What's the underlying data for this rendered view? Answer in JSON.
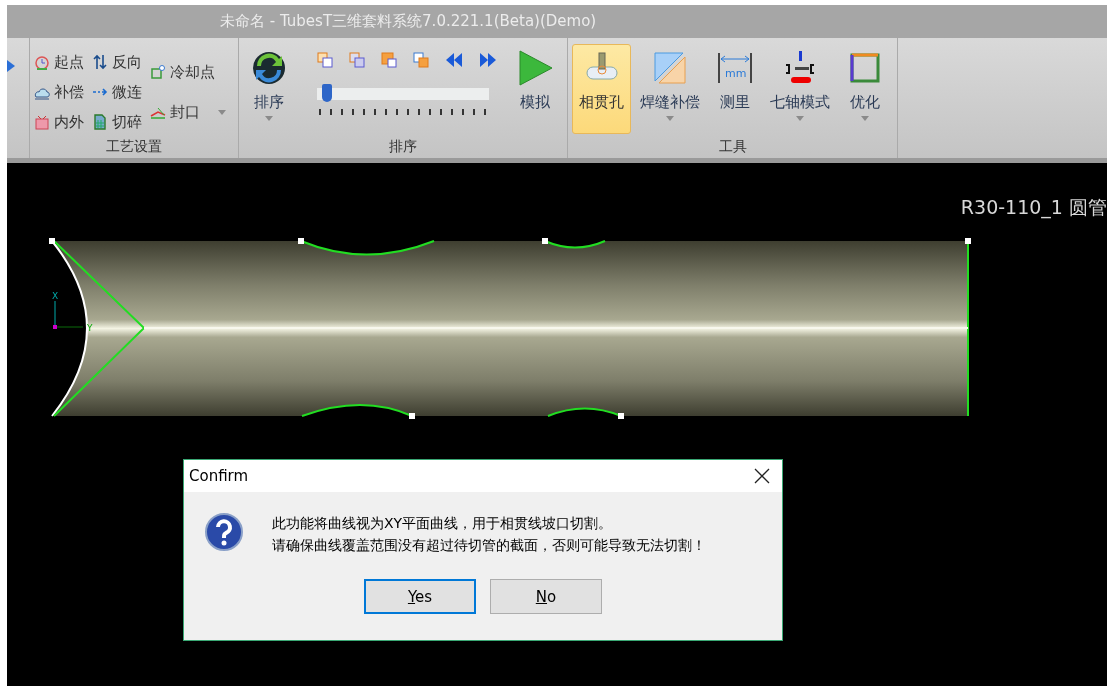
{
  "window": {
    "title": "未命名 - TubesT三维套料系统7.0.221.1(Beta)(Demo)"
  },
  "ribbon": {
    "groups": [
      {
        "kind": "small",
        "label": "工艺设置",
        "items": [
          {
            "label": "起点",
            "dropdown": false
          },
          {
            "label": "补偿",
            "dropdown": false
          },
          {
            "label": "内外",
            "dropdown": false
          },
          {
            "label": "反向",
            "dropdown": false
          },
          {
            "label": "微连",
            "dropdown": false
          },
          {
            "label": "切碎",
            "dropdown": false
          },
          {
            "label": "冷却点",
            "dropdown": false
          },
          {
            "label": "封口",
            "dropdown": true
          }
        ]
      },
      {
        "kind": "sort",
        "label": "排序",
        "sort_button": {
          "label": "排序",
          "dropdown": true
        },
        "slider": {
          "level": 0.03
        },
        "simulate_button": {
          "label": "模拟"
        }
      },
      {
        "kind": "large",
        "label": "工具",
        "items": [
          {
            "label": "相贯孔",
            "selected": true,
            "dropdown": false
          },
          {
            "label": "焊缝补偿",
            "selected": false,
            "dropdown": true
          },
          {
            "label": "测里",
            "selected": false,
            "dropdown": false,
            "icon_text": "mm"
          },
          {
            "label": "七轴模式",
            "selected": false,
            "dropdown": true
          },
          {
            "label": "优化",
            "selected": false,
            "dropdown": true
          }
        ]
      }
    ]
  },
  "viewport": {
    "axis_labels": [
      "X",
      "Y"
    ],
    "part_label": "R30-110_1 圆管"
  },
  "dialog": {
    "title": "Confirm",
    "message_lines": [
      "此功能将曲线视为XY平面曲线，用于相贯线坡口切割。",
      "请确保曲线覆盖范围没有超过待切管的截面，否则可能导致无法切割！"
    ],
    "buttons": [
      {
        "label": "Yes",
        "default": true
      },
      {
        "label": "No",
        "default": false
      }
    ]
  }
}
